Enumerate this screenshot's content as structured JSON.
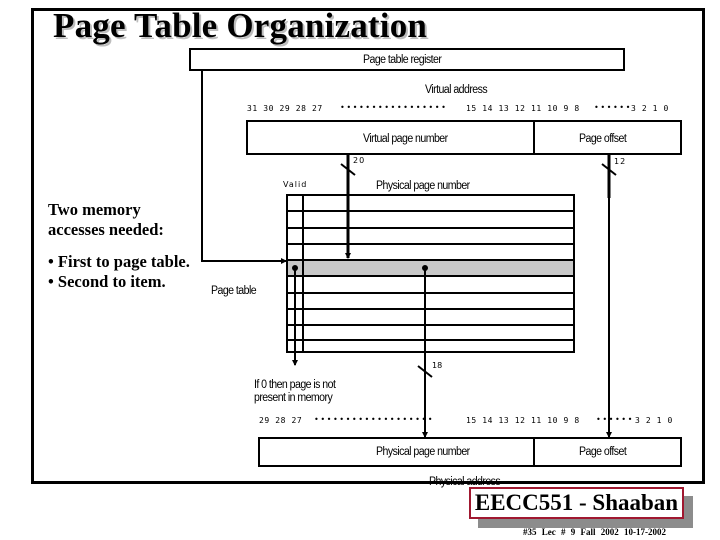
{
  "slide": {
    "title": "Page Table Organization",
    "notes": {
      "line1": "Two memory",
      "line2": "accesses needed:",
      "bullet1": "• First to page table.",
      "bullet2": "• Second to item."
    },
    "brand": "EECC551 - Shaaban",
    "footer": "#35   Lec # 9   Fall 2002  10-17-2002"
  },
  "diagram": {
    "page_table_register": "Page table register",
    "virtual_address": {
      "label": "Virtual address",
      "bits_left": "31 30 29 28 27",
      "dots_left": "•••••••••••••••••",
      "bits_mid": "15 14 13 12 11 10 9 8",
      "dots_right": "••••••",
      "bits_right": "3 2 1 0",
      "vpn_label": "Virtual page number",
      "offset_label": "Page offset",
      "vpn_width": "20",
      "offset_width": "12"
    },
    "page_table": {
      "valid_label": "Valid",
      "ppn_label": "Physical page number",
      "caption": "Page table",
      "rows": 10,
      "highlighted_row": 5,
      "highlight_color": "#c8c8c8",
      "ppn_width": "18"
    },
    "invalid_note": {
      "line1": "If 0 then page is not",
      "line2": "present in memory"
    },
    "physical_address": {
      "label": "Physical address",
      "bits_left": "29 28 27",
      "dots_left": "•••••••••••••••••••",
      "bits_mid": "15 14 13 12 11 10 9 8",
      "dots_right": "••••••",
      "bits_right": "3 2 1 0",
      "ppn_label": "Physical page number",
      "offset_label": "Page offset"
    }
  }
}
